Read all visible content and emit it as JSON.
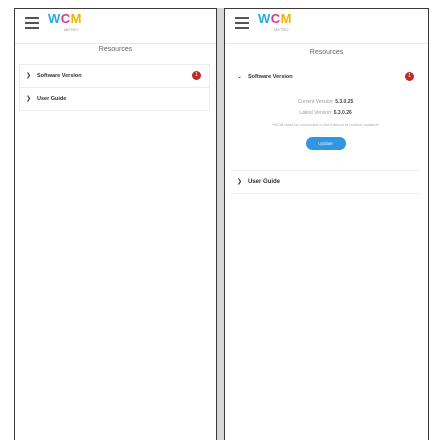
{
  "app": {
    "logo_text": "WCM",
    "logo_subtitle": "METRO",
    "section_title": "Resources"
  },
  "colors": {
    "logo_w": "#2aa9e0",
    "logo_c": "#e0368a",
    "logo_m": "#f0b300",
    "badge": "#c0282a",
    "update_button": "#3196e0"
  },
  "icons": {
    "menu": "hamburger-icon",
    "collapsed": "chevron-right-icon",
    "expanded": "chevron-down-icon",
    "badge": "alert-badge-icon"
  },
  "left_panel": {
    "items": [
      {
        "label": "Software Version",
        "badge": "1"
      },
      {
        "label": "User Guide"
      }
    ]
  },
  "right_panel": {
    "software": {
      "label": "Software Version",
      "badge": "1",
      "current_label": "Current Version:",
      "current_value": "5.3.0.25",
      "latest_label": "Latest Version:",
      "latest_value": "5.3.0.26",
      "note": "*WCM must be connected to the internet to receive updates*",
      "update_button": "Update"
    },
    "user_guide_label": "User Guide"
  }
}
